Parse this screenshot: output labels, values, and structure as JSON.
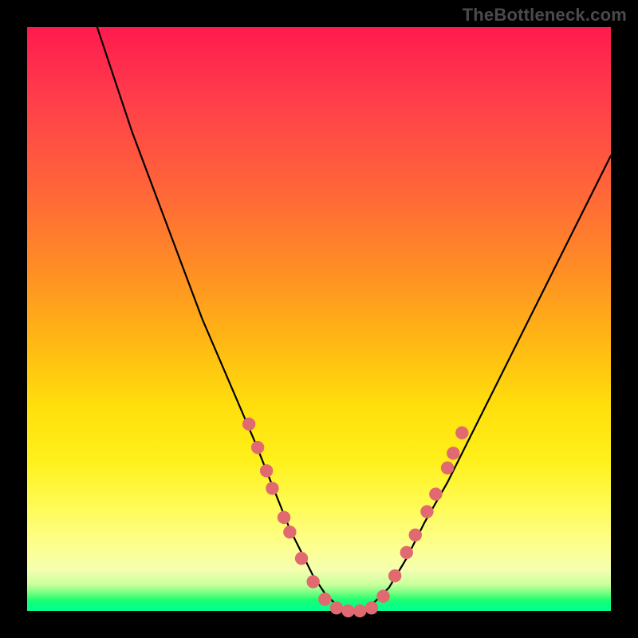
{
  "watermark": "TheBottleneck.com",
  "colors": {
    "frame_bg": "#000000",
    "curve": "#000000",
    "marker_fill": "#e06a6f",
    "marker_stroke": "#aa3a3e",
    "gradient_top": "#ff1a4f",
    "gradient_bottom": "#06ff92"
  },
  "chart_data": {
    "type": "line",
    "title": "",
    "xlabel": "",
    "ylabel": "",
    "xlim": [
      0,
      100
    ],
    "ylim": [
      0,
      100
    ],
    "grid": false,
    "legend": false,
    "series": [
      {
        "name": "curve",
        "x": [
          12,
          15,
          18,
          21,
          24,
          27,
          30,
          33,
          36,
          39,
          41,
          43,
          45,
          47,
          49,
          51,
          53,
          55,
          57,
          59,
          62,
          65,
          68,
          72,
          76,
          80,
          84,
          88,
          92,
          96,
          100
        ],
        "y": [
          100,
          91,
          82,
          74,
          66,
          58,
          50,
          43,
          36,
          29,
          24,
          19,
          14,
          10,
          6,
          3,
          1,
          0,
          0,
          1,
          4,
          9,
          15,
          22,
          30,
          38,
          46,
          54,
          62,
          70,
          78
        ]
      }
    ],
    "markers": [
      {
        "x": 38.0,
        "y": 32.0
      },
      {
        "x": 39.5,
        "y": 28.0
      },
      {
        "x": 41.0,
        "y": 24.0
      },
      {
        "x": 42.0,
        "y": 21.0
      },
      {
        "x": 44.0,
        "y": 16.0
      },
      {
        "x": 45.0,
        "y": 13.5
      },
      {
        "x": 47.0,
        "y": 9.0
      },
      {
        "x": 49.0,
        "y": 5.0
      },
      {
        "x": 51.0,
        "y": 2.0
      },
      {
        "x": 53.0,
        "y": 0.5
      },
      {
        "x": 55.0,
        "y": 0.0
      },
      {
        "x": 57.0,
        "y": 0.0
      },
      {
        "x": 59.0,
        "y": 0.5
      },
      {
        "x": 61.0,
        "y": 2.5
      },
      {
        "x": 63.0,
        "y": 6.0
      },
      {
        "x": 65.0,
        "y": 10.0
      },
      {
        "x": 66.5,
        "y": 13.0
      },
      {
        "x": 68.5,
        "y": 17.0
      },
      {
        "x": 70.0,
        "y": 20.0
      },
      {
        "x": 72.0,
        "y": 24.5
      },
      {
        "x": 73.0,
        "y": 27.0
      },
      {
        "x": 74.5,
        "y": 30.5
      }
    ]
  }
}
